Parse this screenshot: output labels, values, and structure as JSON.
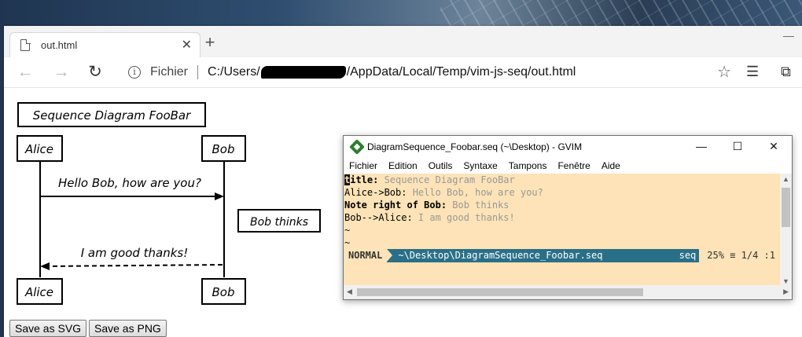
{
  "browser": {
    "tab_title": "out.html",
    "tab_close": "✕",
    "new_tab": "+",
    "address_prefix": "Fichier",
    "url_start": "C:/Users/",
    "url_end": "/AppData/Local/Temp/vim-js-seq/out.html"
  },
  "diagram": {
    "title": "Sequence Diagram FooBar",
    "actor_left": "Alice",
    "actor_right": "Bob",
    "message_1": "Hello Bob, how are you?",
    "note": "Bob thinks",
    "message_2": "I am good thanks!"
  },
  "buttons": {
    "save_svg": "Save as SVG",
    "save_png": "Save as PNG"
  },
  "gvim": {
    "window_title": "DiagramSequence_Foobar.seq (~\\Desktop) - GVIM",
    "menu": [
      "Fichier",
      "Edition",
      "Outils",
      "Syntaxe",
      "Tampons",
      "Fenêtre",
      "Aide"
    ],
    "lines": [
      {
        "cursor": "t",
        "kw": "itle:",
        "text": " Sequence Diagram FooBar"
      },
      {
        "kw": "Alice->Bob:",
        "text": " Hello Bob, how are you?"
      },
      {
        "kw": "Note right of Bob:",
        "text": " Bob thinks"
      },
      {
        "kw": "Bob-->Alice:",
        "text": " I am good thanks!"
      }
    ],
    "tilde": "~",
    "status_mode": "NORMAL",
    "status_file": "~\\Desktop\\DiagramSequence_Foobar.seq",
    "status_type": "seq",
    "status_percent": "25%",
    "status_pos": "≡ 1/4 :1"
  },
  "colors": {
    "vim_bg": "#fde3b7",
    "statusline": "#2a6f88"
  }
}
